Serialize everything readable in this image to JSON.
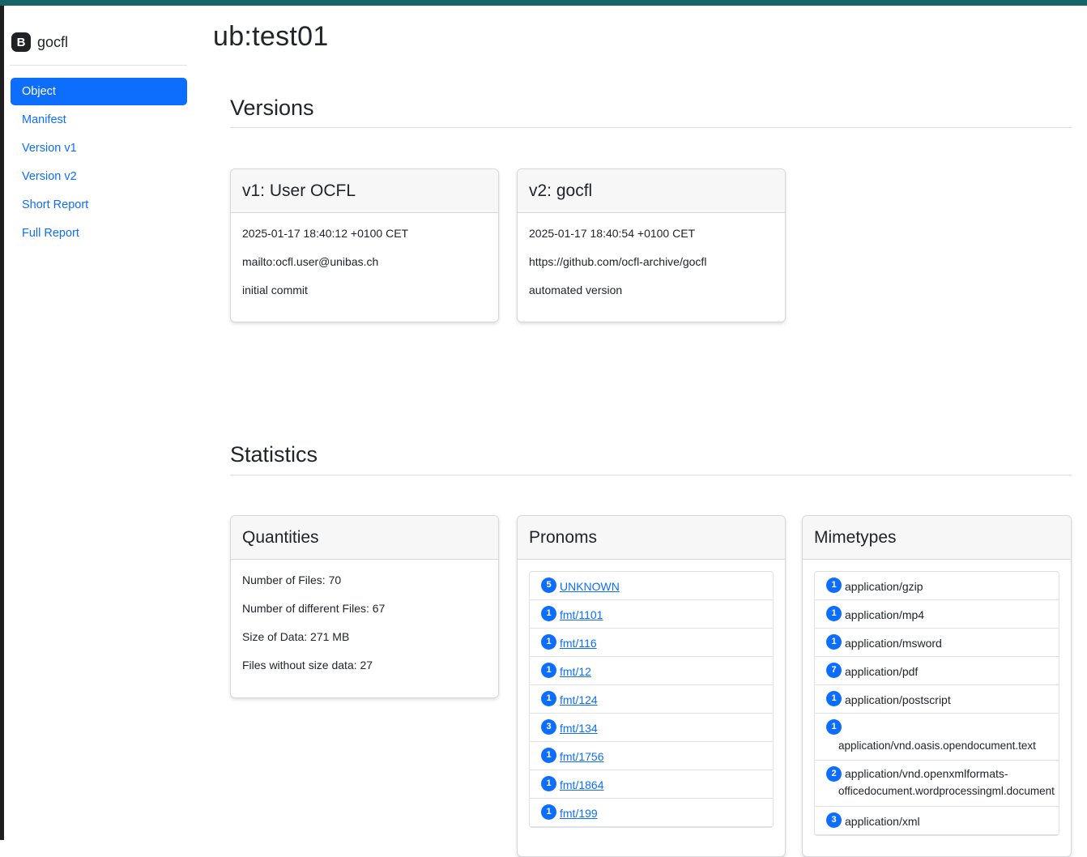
{
  "brand": {
    "logo_letter": "B",
    "name": "gocfl"
  },
  "nav": [
    "Object",
    "Manifest",
    "Version v1",
    "Version v2",
    "Short Report",
    "Full Report"
  ],
  "page_title": "ub:test01",
  "versions": {
    "heading": "Versions",
    "cards": [
      {
        "title": "v1: User OCFL",
        "date": "2025-01-17 18:40:12 +0100 CET",
        "user": "mailto:ocfl.user@unibas.ch",
        "message": "initial commit"
      },
      {
        "title": "v2: gocfl",
        "date": "2025-01-17 18:40:54 +0100 CET",
        "user": "https://github.com/ocfl-archive/gocfl",
        "message": "automated version"
      }
    ]
  },
  "statistics": {
    "heading": "Statistics",
    "quantities": {
      "title": "Quantities",
      "lines": [
        "Number of Files: 70",
        "Number of different Files: 67",
        "Size of Data: 271 MB",
        "Files without size data: 27"
      ]
    },
    "pronoms": {
      "title": "Pronoms",
      "items": [
        {
          "count": "5",
          "label": "UNKNOWN"
        },
        {
          "count": "1",
          "label": "fmt/1101"
        },
        {
          "count": "1",
          "label": "fmt/116"
        },
        {
          "count": "1",
          "label": "fmt/12"
        },
        {
          "count": "1",
          "label": "fmt/124"
        },
        {
          "count": "3",
          "label": "fmt/134"
        },
        {
          "count": "1",
          "label": "fmt/1756"
        },
        {
          "count": "1",
          "label": "fmt/1864"
        },
        {
          "count": "1",
          "label": "fmt/199"
        }
      ]
    },
    "mimetypes": {
      "title": "Mimetypes",
      "items": [
        {
          "count": "1",
          "label": "application/gzip"
        },
        {
          "count": "1",
          "label": "application/mp4"
        },
        {
          "count": "1",
          "label": "application/msword"
        },
        {
          "count": "7",
          "label": "application/pdf"
        },
        {
          "count": "1",
          "label": "application/postscript"
        },
        {
          "count": "1",
          "label": "application/vnd.oasis.opendocument.text"
        },
        {
          "count": "2",
          "label": "application/vnd.openxmlformats-",
          "label2": "officedocument.wordprocessingml.document"
        },
        {
          "count": "3",
          "label": "application/xml"
        }
      ]
    }
  },
  "colors": {
    "accent": "#0d6efd",
    "topbar": "#176468"
  }
}
